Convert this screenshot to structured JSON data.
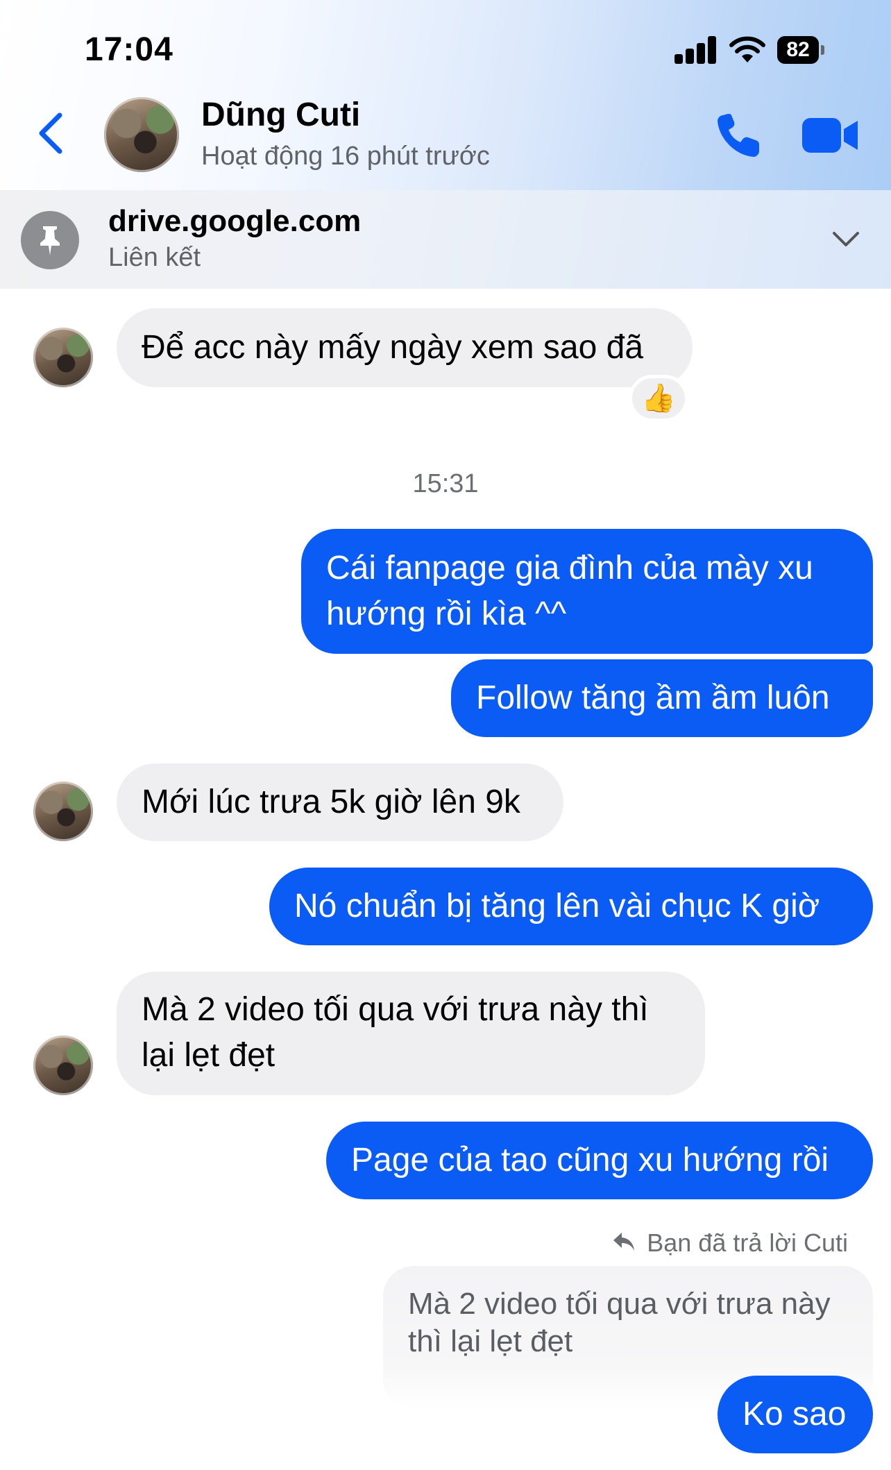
{
  "status_bar": {
    "time": "17:04",
    "battery": "82"
  },
  "header": {
    "name": "Dũng Cuti",
    "status": "Hoạt động 16 phút trước"
  },
  "pinned": {
    "title": "drive.google.com",
    "subtitle": "Liên kết"
  },
  "icons": {
    "back": "chevron-left-icon",
    "call": "phone-icon",
    "video": "video-camera-icon",
    "pin": "pin-icon",
    "expand": "chevron-down-icon",
    "reply": "reply-arrow-icon",
    "reaction": "thumbs-up-emoji"
  },
  "colors": {
    "accent": "#0b5cf5",
    "incoming_bubble": "#efeff1",
    "secondary_text": "#5f6368"
  },
  "messages": [
    {
      "from": "them",
      "text": "Để acc này mấy ngày xem sao đã",
      "reaction": "👍"
    },
    {
      "type": "timestamp",
      "text": "15:31"
    },
    {
      "from": "me",
      "text": "Cái fanpage gia đình của mày xu hướng rồi kìa ^^"
    },
    {
      "from": "me",
      "text": "Follow tăng ầm ầm luôn"
    },
    {
      "from": "them",
      "text": "Mới lúc trưa 5k giờ lên 9k"
    },
    {
      "from": "me",
      "text": "Nó chuẩn bị tăng lên vài chục K giờ"
    },
    {
      "from": "them",
      "text": "Mà 2 video tối qua với trưa này thì lại lẹt đẹt"
    },
    {
      "from": "me",
      "text": "Page của tao cũng xu hướng rồi"
    },
    {
      "type": "reply_note",
      "text": "Bạn đã trả lời Cuti"
    },
    {
      "type": "quoted",
      "text": "Mà 2 video tối qua với trưa này thì lại lẹt đẹt"
    },
    {
      "from": "me",
      "text": "Ko sao"
    }
  ]
}
